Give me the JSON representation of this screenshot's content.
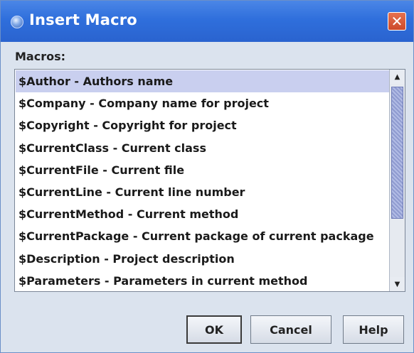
{
  "window": {
    "title": "Insert Macro",
    "close_label": "✕"
  },
  "macros": {
    "label": "Macros:",
    "items": [
      "$Author - Authors name",
      "$Company - Company name for project",
      "$Copyright - Copyright for project",
      "$CurrentClass - Current class",
      "$CurrentFile - Current file",
      "$CurrentLine - Current line number",
      "$CurrentMethod - Current method",
      "$CurrentPackage - Current package of current package",
      "$Description - Project description",
      "$Parameters - Parameters in current method"
    ],
    "selected_index": 0
  },
  "scrollbar": {
    "up_label": "▲",
    "down_label": "▼"
  },
  "buttons": {
    "ok": "OK",
    "cancel": "Cancel",
    "help": "Help"
  },
  "colors": {
    "title_bar": "#2f6fdc",
    "close_button": "#d45a36",
    "selection": "#c9cfef"
  }
}
